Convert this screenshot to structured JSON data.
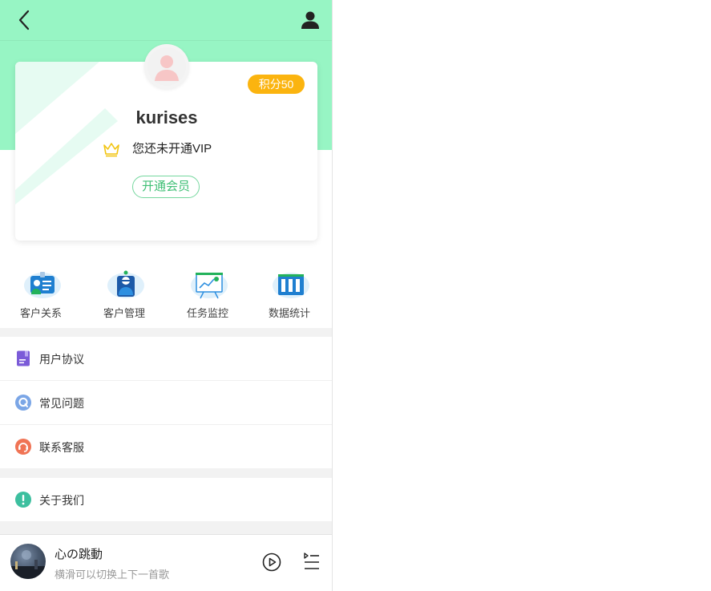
{
  "profile": {
    "username": "kurises",
    "points_badge": "积分50",
    "vip_status": "您还未开通VIP",
    "open_member_label": "开通会员"
  },
  "shortcuts": [
    {
      "label": "客户关系",
      "icon": "id-card-icon"
    },
    {
      "label": "客户管理",
      "icon": "customer-profile-icon"
    },
    {
      "label": "任务监控",
      "icon": "presentation-board-icon"
    },
    {
      "label": "数据统计",
      "icon": "data-columns-icon"
    }
  ],
  "menu": {
    "group1": [
      {
        "label": "用户协议",
        "icon": "document-icon",
        "color": "#7b5bd8"
      },
      {
        "label": "常见问题",
        "icon": "question-icon",
        "color": "#7ba6e6"
      },
      {
        "label": "联系客服",
        "icon": "customer-service-icon",
        "color": "#f07455"
      }
    ],
    "group2": [
      {
        "label": "关于我们",
        "icon": "info-icon",
        "color": "#3dbf9f"
      }
    ]
  },
  "player": {
    "title": "心の跳動",
    "subtitle": "横滑可以切换上下一首歌"
  },
  "colors": {
    "header_green": "#97f5c4",
    "badge_orange": "#fbb40f",
    "member_green": "#3fbf75"
  }
}
